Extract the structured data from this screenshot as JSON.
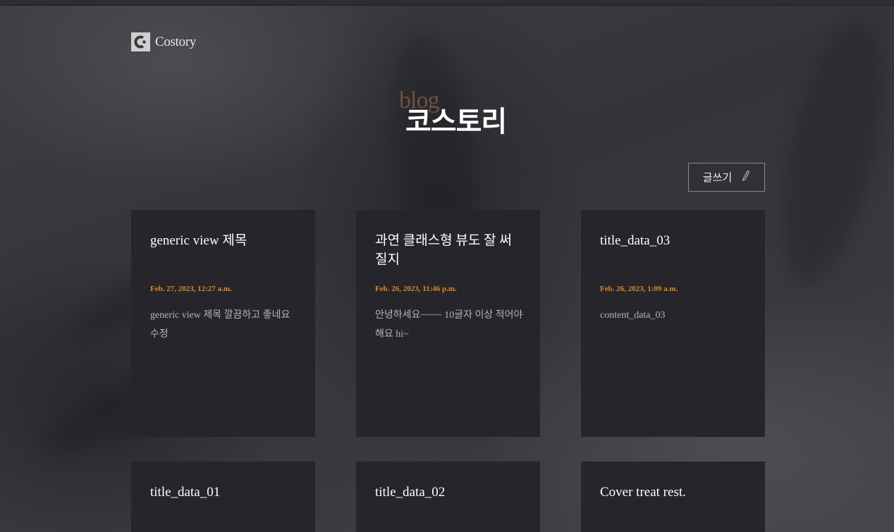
{
  "header": {
    "logo_text": "Costory"
  },
  "hero": {
    "subtitle": "blog",
    "title": "코스토리"
  },
  "toolbar": {
    "write_label": "글쓰기"
  },
  "icons": {
    "logo": "c-logo-icon",
    "write": "pencil-icon"
  },
  "colors": {
    "accent": "#d98a1e",
    "card_bg": "#26252b",
    "page_bg": "#3b3a3f"
  },
  "posts": [
    {
      "title": "generic view 제목",
      "date": "Feb. 27, 2023, 12:27 a.m.",
      "content": "generic view 제목 깔끔하고 좋네요 수정"
    },
    {
      "title": "과연 클래스형 뷰도 잘 써질지",
      "date": "Feb. 26, 2023, 11:46 p.m.",
      "content": "안녕하세요~~~~ 10글자 이상 적어야 해요 hi~"
    },
    {
      "title": "title_data_03",
      "date": "Feb. 26, 2023, 1:09 a.m.",
      "content": "content_data_03"
    },
    {
      "title": "title_data_01"
    },
    {
      "title": "title_data_02"
    },
    {
      "title": "Cover treat rest."
    }
  ]
}
